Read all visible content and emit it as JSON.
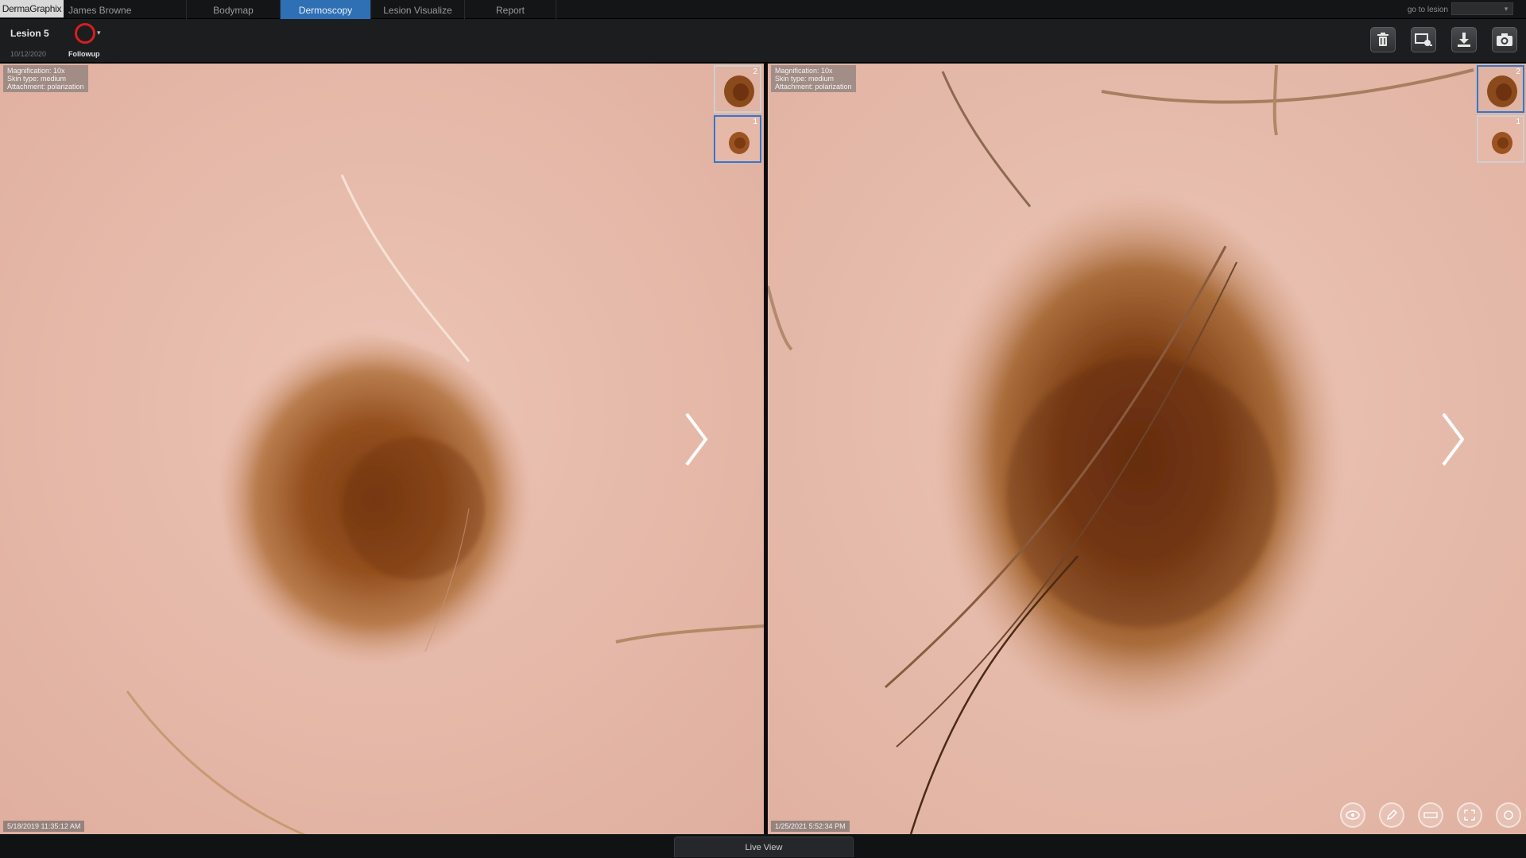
{
  "app": {
    "logo": "DermaGraphix",
    "patient_name": "James Browne"
  },
  "tabs": [
    {
      "label": "Bodymap",
      "active": false
    },
    {
      "label": "Dermoscopy",
      "active": true
    },
    {
      "label": "Lesion Visualize",
      "active": false
    },
    {
      "label": "Report",
      "active": false
    }
  ],
  "goto": {
    "label": "go to lesion"
  },
  "toolbar": {
    "lesion_name": "Lesion 5",
    "lesion_date": "10/12/2020",
    "followup_label": "Followup",
    "followup_color": "#d81e1e",
    "buttons": [
      {
        "name": "delete",
        "icon": "trash-icon"
      },
      {
        "name": "compare",
        "icon": "image-compare-icon"
      },
      {
        "name": "export",
        "icon": "download-icon"
      },
      {
        "name": "capture",
        "icon": "camera-icon"
      }
    ]
  },
  "panels": [
    {
      "info": [
        "Magnification: 10x",
        "Skin type: medium",
        "Attachment: polarization"
      ],
      "timestamp": "5/18/2019 11:35:12 AM",
      "thumbnails": [
        {
          "number": "2",
          "selected": false
        },
        {
          "number": "1",
          "selected": true
        }
      ]
    },
    {
      "info": [
        "Magnification: 10x",
        "Skin type: medium",
        "Attachment: polarization"
      ],
      "timestamp": "1/25/2021 5:52:34 PM",
      "thumbnails": [
        {
          "number": "2",
          "selected": true
        },
        {
          "number": "1",
          "selected": false
        }
      ]
    }
  ],
  "view_tools": [
    {
      "name": "eye",
      "icon": "eye-icon"
    },
    {
      "name": "annotate",
      "icon": "pencil-icon"
    },
    {
      "name": "measure",
      "icon": "ruler-icon"
    },
    {
      "name": "fullscreen",
      "icon": "expand-icon"
    },
    {
      "name": "more",
      "icon": "more-icon"
    }
  ],
  "bottom": {
    "live_view_label": "Live View"
  },
  "colors": {
    "accent": "#2f6fb3",
    "skin": "#e8bcae",
    "lesion": "#8a4a1c"
  }
}
